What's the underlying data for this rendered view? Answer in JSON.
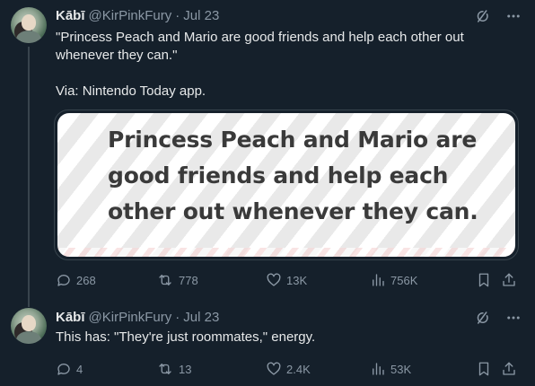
{
  "tweets": [
    {
      "author": {
        "name": "Kābī",
        "handle": "@KirPinkFury",
        "separator": "·",
        "date": "Jul 23"
      },
      "text": "\"Princess Peach and Mario are good friends and help each other out whenever they can.\"\n\nVia: Nintendo Today app.",
      "media_text": "Princess Peach and Mario are good friends and help each other out whenever they can.",
      "stats": {
        "replies": "268",
        "reposts": "778",
        "likes": "13K",
        "views": "756K"
      }
    },
    {
      "author": {
        "name": "Kābī",
        "handle": "@KirPinkFury",
        "separator": "·",
        "date": "Jul 23"
      },
      "text": "This has: \"They're just roommates,\" energy.",
      "stats": {
        "replies": "4",
        "reposts": "13",
        "likes": "2.4K",
        "views": "53K"
      }
    }
  ],
  "icons": {
    "top_left": "grok-icon",
    "top_right": "more-icon",
    "reply": "reply-icon",
    "repost": "repost-icon",
    "like": "heart-icon",
    "views": "views-icon",
    "bookmark": "bookmark-icon",
    "share": "share-icon"
  },
  "colors": {
    "background": "#15202b",
    "text": "#e7e9ea",
    "muted": "#8b98a5",
    "border": "#38444d"
  }
}
